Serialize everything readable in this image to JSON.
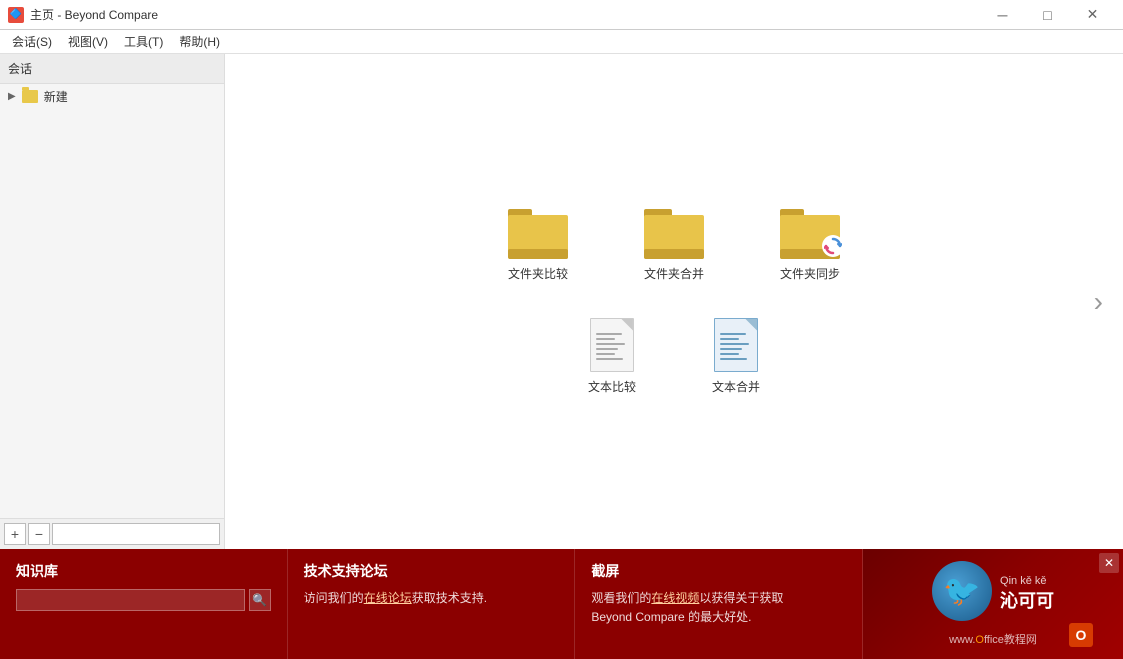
{
  "titlebar": {
    "icon": "BC",
    "title": "主页 - Beyond Compare",
    "minimize": "─",
    "maximize": "□",
    "close": "✕"
  },
  "menubar": {
    "items": [
      {
        "label": "会话(S)"
      },
      {
        "label": "视图(V)"
      },
      {
        "label": "工具(T)"
      },
      {
        "label": "帮助(H)"
      }
    ]
  },
  "sidebar": {
    "header": "会话",
    "new_item": "新建",
    "add_btn": "+",
    "remove_btn": "−"
  },
  "content": {
    "row1": [
      {
        "label": "文件夹比较",
        "type": "folder"
      },
      {
        "label": "文件夹合并",
        "type": "folder"
      },
      {
        "label": "文件夹同步",
        "type": "folder-sync"
      }
    ],
    "row2": [
      {
        "label": "文本比较",
        "type": "doc"
      },
      {
        "label": "文本合并",
        "type": "doc-blue"
      }
    ],
    "nav_arrow": "›"
  },
  "bottom": {
    "close": "✕",
    "sections": [
      {
        "title": "知识库",
        "search_placeholder": "",
        "search_icon": "🔍"
      },
      {
        "title": "技术支持论坛",
        "text_before": "访问我们的",
        "link": "在线论坛",
        "text_after": "获取技术支持."
      },
      {
        "title": "截屏",
        "text_before": "观看我们的",
        "link": "在线视频",
        "text_after": "以获得关于获取\nBeyond Compare 的最大好处."
      }
    ],
    "logo": {
      "pinyin": "Qin  kě  kě",
      "name": "沁可可",
      "site": "www.Office教程网"
    }
  }
}
